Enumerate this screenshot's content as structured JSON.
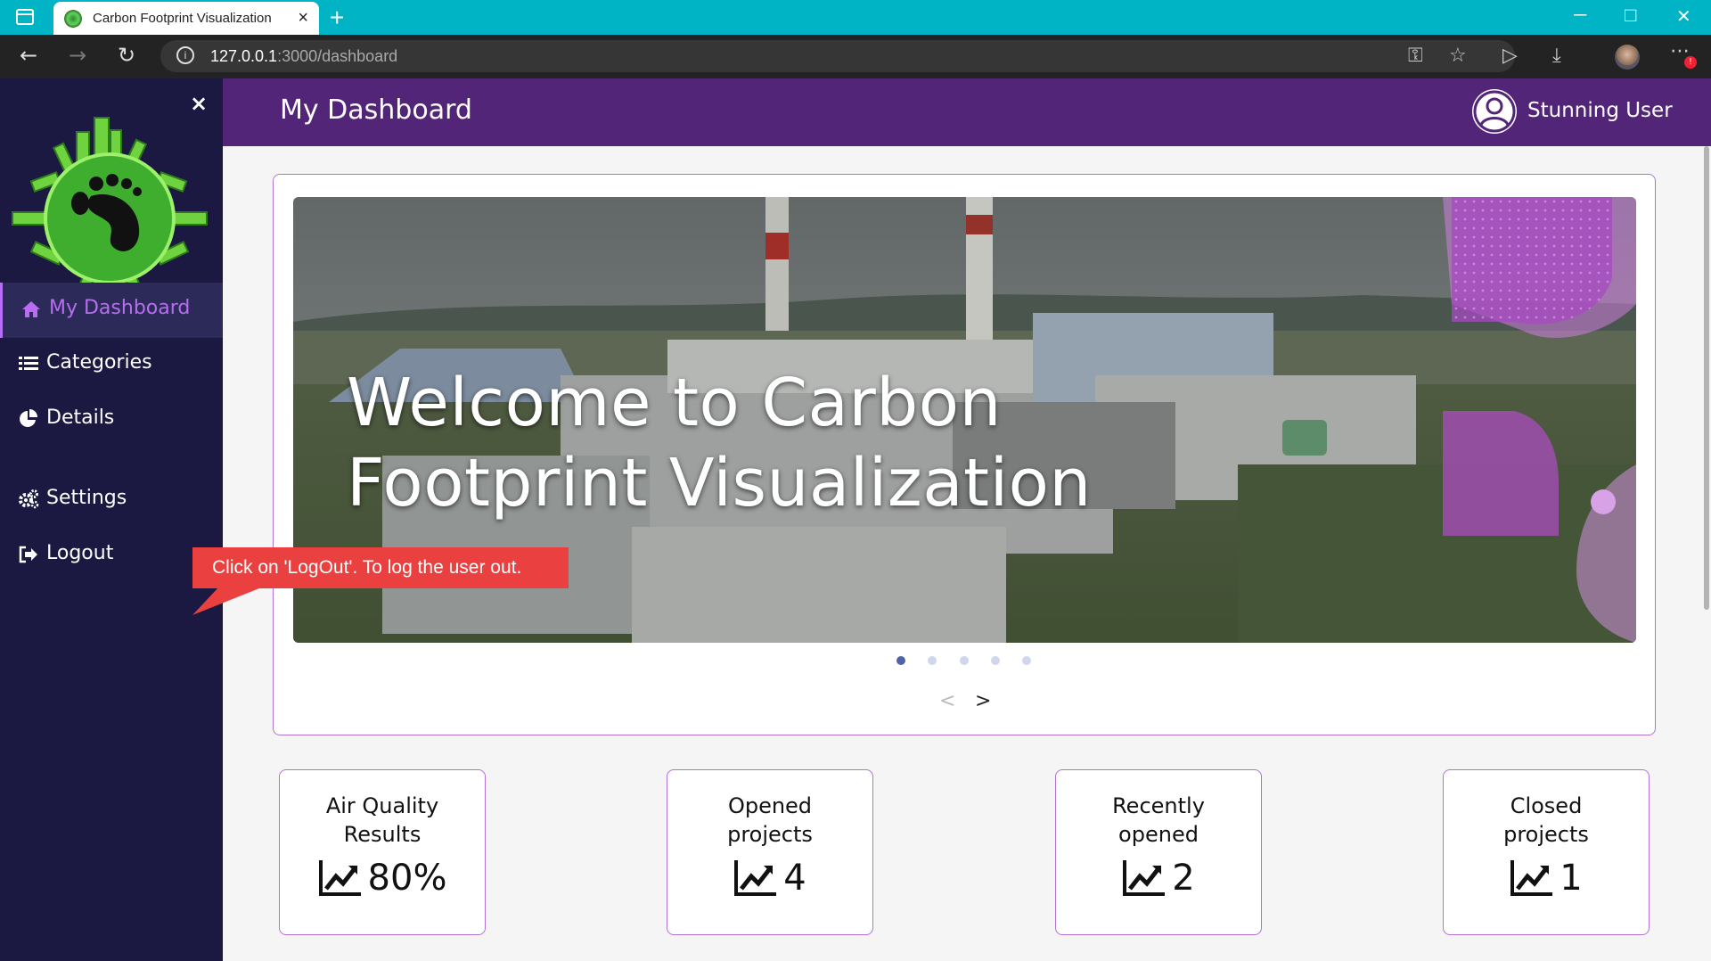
{
  "browser": {
    "tab_title": "Carbon Footprint Visualization",
    "tab_close": "×",
    "new_tab": "+",
    "url_host": "127.0.0.1",
    "url_rest": ":3000/dashboard",
    "url_info": "i"
  },
  "sidebar": {
    "close": "×",
    "items": [
      {
        "label": "My Dashboard",
        "icon": "home-icon",
        "active": true
      },
      {
        "label": "Categories",
        "icon": "list-icon"
      },
      {
        "label": "Details",
        "icon": "pie-chart-icon"
      },
      {
        "label": "Settings",
        "icon": "gears-icon"
      },
      {
        "label": "Logout",
        "icon": "sign-out-icon"
      }
    ]
  },
  "header": {
    "title": "My Dashboard",
    "user_name": "Stunning User"
  },
  "carousel": {
    "title_line1": "Welcome to Carbon",
    "title_line2": "Footprint Visualization",
    "active_slide": 1,
    "slide_count": 5,
    "prev": "<",
    "next": ">"
  },
  "stats": [
    {
      "label_line1": "Air Quality",
      "label_line2": "Results",
      "value": "80%"
    },
    {
      "label_line1": "Opened",
      "label_line2": "projects",
      "value": "4"
    },
    {
      "label_line1": "Recently",
      "label_line2": "opened",
      "value": "2"
    },
    {
      "label_line1": "Closed",
      "label_line2": "projects",
      "value": "1"
    }
  ],
  "callout": {
    "text": "Click on 'LogOut'. To log the user out."
  },
  "colors": {
    "tabbar": "#00b4c6",
    "sidebar": "#1b1842",
    "header": "#522579",
    "accent": "#b071d8",
    "active_nav": "#b86df0",
    "callout": "#ea4040"
  }
}
